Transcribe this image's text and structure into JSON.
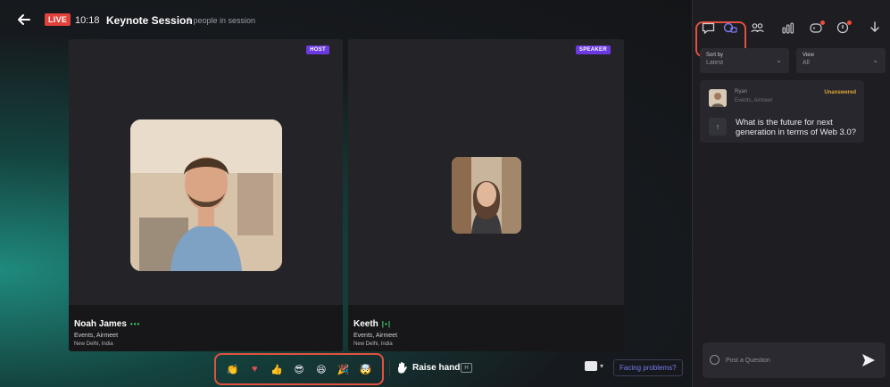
{
  "header": {
    "live_label": "LIVE",
    "time": "10:18",
    "session_title": "Keynote Session",
    "people_count": "3 people in session"
  },
  "tiles": [
    {
      "role": "HOST",
      "name": "Noah James",
      "org": "Events, Airmeet",
      "location": "New Delhi, India"
    },
    {
      "role": "SPEAKER",
      "name": "Keeth",
      "org": "Events, Airmeet",
      "location": "New Delhi, India"
    }
  ],
  "toolbar": {
    "reactions": [
      "clap-icon",
      "heart-icon",
      "thumbs-up-icon",
      "cool-face-icon",
      "laugh-face-icon",
      "party-popper-icon",
      "mind-blown-icon"
    ],
    "raise_hand_label": "Raise hand",
    "raise_hand_shortcut": "H",
    "facing_problems_label": "Facing problems?"
  },
  "panel": {
    "tabs": [
      "chat-icon",
      "questions-icon",
      "people-icon",
      "polls-icon",
      "reactions-tab-icon",
      "notifications-icon",
      "download-icon"
    ],
    "sort_label": "Sort by",
    "sort_value": "Latest",
    "view_label": "View",
    "view_value": "All",
    "question": {
      "author": "Ryan",
      "author_org": "Events, Airmeet",
      "status": "Unanswered",
      "text": "What is the future for next generation in terms of Web 3.0?"
    },
    "ask_placeholder": "Post a Question"
  },
  "colors": {
    "accent": "#7b7cf0",
    "live": "#e0413a",
    "highlight": "#e2513f",
    "tag": "#6b39e0",
    "unanswered": "#e0a435"
  }
}
